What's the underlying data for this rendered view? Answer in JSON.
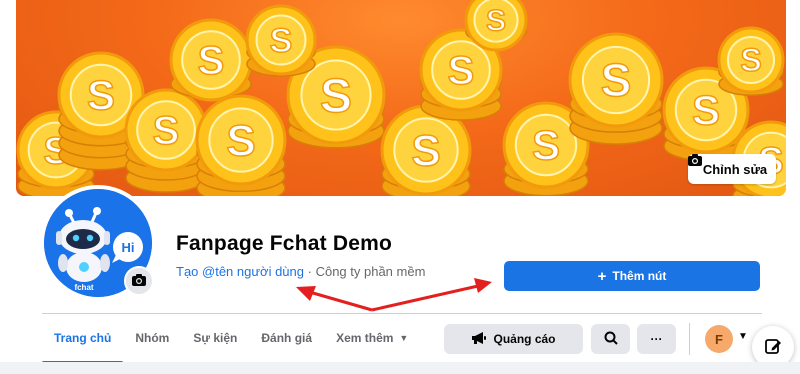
{
  "cover": {
    "edit_label": "Chỉnh sửa",
    "coin_symbol": "S",
    "colors": {
      "bg": "#f46a19",
      "coin": "#ffc21a"
    }
  },
  "avatar": {
    "hi_text": "Hi",
    "brand_text": "fchat"
  },
  "page": {
    "name": "Fanpage Fchat Demo",
    "username_link": "Tạo @tên người dùng",
    "separator": " · ",
    "category": "Công ty phần mềm"
  },
  "actions": {
    "add_button_label": "Thêm nút"
  },
  "nav": {
    "tabs": [
      {
        "label": "Trang chủ",
        "active": true
      },
      {
        "label": "Nhóm"
      },
      {
        "label": "Sự kiện"
      },
      {
        "label": "Đánh giá"
      },
      {
        "label": "Xem thêm",
        "has_caret": true
      }
    ],
    "ads_label": "Quảng cáo",
    "more_label": "···"
  },
  "profile": {
    "initial": "F"
  },
  "accent": "#1b74e4"
}
